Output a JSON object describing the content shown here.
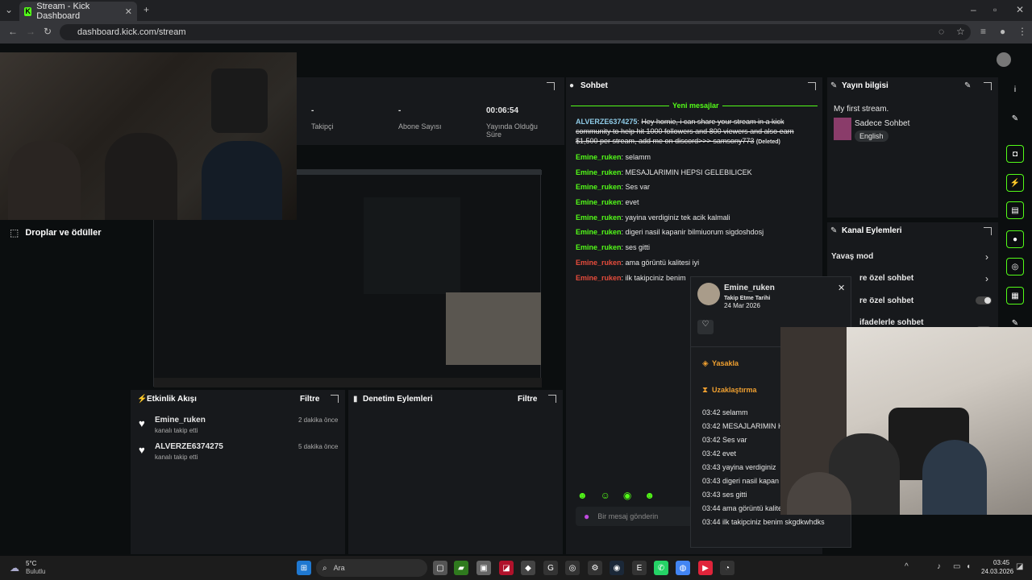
{
  "browser": {
    "tab_title": "Stream - Kick Dashboard",
    "url": "dashboard.kick.com/stream"
  },
  "stats": {
    "followers_value": "-",
    "followers_label": "Takipçi",
    "subs_value": "-",
    "subs_label": "Abone Sayısı",
    "uptime_value": "00:06:54",
    "uptime_label": "Yayında Olduğu Süre"
  },
  "drops": {
    "title": "Droplar ve ödüller"
  },
  "chat": {
    "title": "Sohbet",
    "new_messages": "Yeni mesajlar",
    "deleted_user": "ALVERZE6374275",
    "deleted_text": "Hey homie, i can share your stream in a kick community to help hit 1000 followers and 800 viewers and also earn $1,500 per stream, add me on discord>>> samsony773",
    "deleted_tag": "(Deleted)",
    "messages": [
      {
        "user": "Emine_ruken",
        "text": ": selamm",
        "color": "g"
      },
      {
        "user": "Emine_ruken",
        "text": ": MESAJLARIMIN HEPSI GELEBILICEK",
        "color": "g"
      },
      {
        "user": "Emine_ruken",
        "text": ": Ses var",
        "color": "g"
      },
      {
        "user": "Emine_ruken",
        "text": ": evet",
        "color": "g"
      },
      {
        "user": "Emine_ruken",
        "text": ": yayina verdiginiz tek acik kalmali",
        "color": "g"
      },
      {
        "user": "Emine_ruken",
        "text": ": digeri nasil kapanir bilmiuorum sigdoshdosj",
        "color": "g"
      },
      {
        "user": "Emine_ruken",
        "text": ": ses gitti",
        "color": "g"
      },
      {
        "user": "Emine_ruken",
        "text": ": ama görüntü kalitesi iyi",
        "color": "r"
      },
      {
        "user": "Emine_ruken",
        "text": ": ilk takipciniz benim",
        "color": "r"
      }
    ],
    "input_placeholder": "Bir mesaj gönderin"
  },
  "user_card": {
    "name": "Emine_ruken",
    "follow_label": "Takip Etme Tarihi",
    "follow_date": "24 Mar 2026",
    "ban": "Yasakla",
    "timeout": "Uzaklaştırma",
    "history": [
      "03:42 selamm",
      "03:42 MESAJLARIMIN H GELEBILICEK",
      "03:42 Ses var",
      "03:42 evet",
      "03:43 yayina verdiginiz",
      "03:43 digeri nasil kapan sigdoshdosj",
      "03:43 ses gitti",
      "03:44 ama görüntü kalitesi iyi",
      "03:44 ilk takipciniz benim skgdkwhdks"
    ]
  },
  "stream_info": {
    "title": "Yayın bilgisi",
    "stream_title": "My first stream.",
    "category": "Sadece Sohbet",
    "language": "English"
  },
  "channel_actions": {
    "title": "Kanal Eylemleri",
    "slow_mode": "Yavaş mod",
    "row2": "re özel sohbet",
    "row3": "re özel sohbet",
    "row4": "ifadelerle sohbet"
  },
  "activity": {
    "title": "Etkinlik Akışı",
    "filter": "Filtre",
    "items": [
      {
        "name": "Emine_ruken",
        "sub": "kanalı takip etti",
        "time": "2 dakika önce"
      },
      {
        "name": "ALVERZE6374275",
        "sub": "kanalı takip etti",
        "time": "5 dakika önce"
      }
    ]
  },
  "moderation": {
    "title": "Denetim Eylemleri",
    "filter": "Filtre"
  },
  "taskbar": {
    "weather_temp": "5°C",
    "weather_desc": "Bulutlu",
    "search": "Ara",
    "time": "03:45",
    "date": "24.03.2026"
  }
}
